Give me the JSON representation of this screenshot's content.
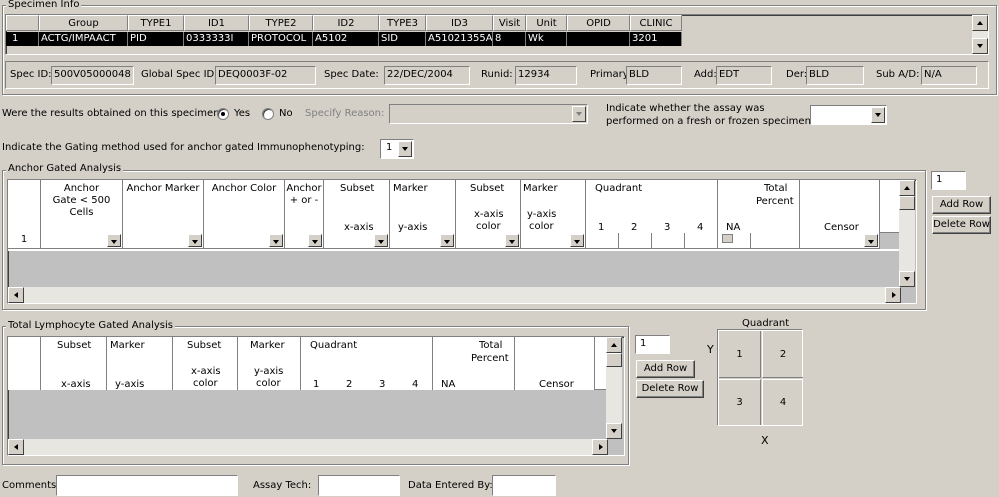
{
  "specimen_info": {
    "legend": "Specimen Info",
    "columns": [
      "Group",
      "TYPE1",
      "ID1",
      "TYPE2",
      "ID2",
      "TYPE3",
      "ID3",
      "Visit",
      "Unit",
      "OPID",
      "CLINIC"
    ],
    "row": {
      "num": "1",
      "cells": [
        "ACTG/IMPAACT",
        "PID",
        "0333333I",
        "PROTOCOL",
        "A5102",
        "SID",
        "A51021355A",
        "8",
        "Wk",
        "",
        "3201"
      ]
    },
    "spec_id_label": "Spec ID:",
    "spec_id": "500V05000048",
    "global_spec_id_label": "Global Spec ID:",
    "global_spec_id": "DEQ0003F-02",
    "spec_date_label": "Spec Date:",
    "spec_date": "22/DEC/2004",
    "runid_label": "Runid:",
    "runid": "12934",
    "primary_label": "Primary:",
    "primary": "BLD",
    "add_label": "Add:",
    "add": "EDT",
    "der_label": "Der:",
    "der": "BLD",
    "sub_ad_label": "Sub A/D:",
    "sub_ad": "N/A"
  },
  "questions": {
    "results_question": "Were the results obtained on this specimen?",
    "yes_label": "Yes",
    "no_label": "No",
    "specify_reason_label": "Specify Reason:",
    "assay_question_line1": "Indicate whether the assay was",
    "assay_question_line2": "performed on a fresh or frozen specimen:",
    "gating_question": "Indicate the Gating method used for anchor gated Immunophenotyping:",
    "gating_value": "1"
  },
  "anchor": {
    "legend": "Anchor Gated Analysis",
    "headers": {
      "anchor_gate_1": "Anchor",
      "anchor_gate_2": "Gate < 500",
      "anchor_gate_3": "Cells",
      "anchor_marker": "Anchor Marker",
      "anchor_color": "Anchor Color",
      "anchor_pm_1": "Anchor",
      "anchor_pm_2": "+ or -",
      "subset": "Subset",
      "marker": "Marker",
      "x_axis": "x-axis",
      "y_axis": "y-axis",
      "subset2": "Subset",
      "marker2": "Marker",
      "x_axis_color_1": "x-axis",
      "x_axis_color_2": "color",
      "y_axis_color_1": "y-axis",
      "y_axis_color_2": "color",
      "quadrant": "Quadrant",
      "q1": "1",
      "q2": "2",
      "q3": "3",
      "q4": "4",
      "total_1": "Total",
      "total_2": "Percent",
      "na": "NA",
      "censor": "Censor"
    },
    "row_num": "1",
    "row_count": "1",
    "add_row": "Add Row",
    "delete_row": "Delete Row"
  },
  "lymph": {
    "legend": "Total Lymphocyte Gated Analysis",
    "headers": {
      "subset": "Subset",
      "marker": "Marker",
      "x_axis": "x-axis",
      "y_axis": "y-axis",
      "subset2": "Subset",
      "marker2": "Marker",
      "x_axis_color_1": "x-axis",
      "x_axis_color_2": "color",
      "y_axis_color_1": "y-axis",
      "y_axis_color_2": "color",
      "quadrant": "Quadrant",
      "q1": "1",
      "q2": "2",
      "q3": "3",
      "q4": "4",
      "total_1": "Total",
      "total_2": "Percent",
      "na": "NA",
      "censor": "Censor"
    },
    "row_count": "1",
    "add_row": "Add Row",
    "delete_row": "Delete Row"
  },
  "quadrant_diagram": {
    "title": "Quadrant",
    "y_label": "Y",
    "x_label": "X",
    "q1": "1",
    "q2": "2",
    "q3": "3",
    "q4": "4"
  },
  "footer": {
    "comments_label": "Comments:",
    "assay_tech_label": "Assay Tech:",
    "data_entered_label": "Data Entered By:"
  },
  "icons": [
    "chevron-down-icon",
    "scroll-up-icon",
    "scroll-down-icon",
    "scroll-left-icon",
    "scroll-right-icon"
  ],
  "colors": {
    "face": "#d4d0c8",
    "selection": "#000000",
    "shadow": "#808080",
    "field": "#ffffff"
  }
}
